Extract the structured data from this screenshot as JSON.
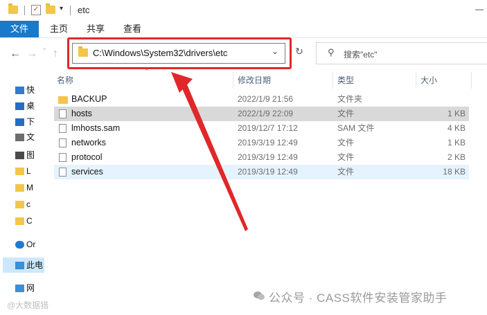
{
  "window": {
    "title": "etc",
    "minimize_glyph": "—"
  },
  "ribbon": {
    "tabs": [
      {
        "label": "文件"
      },
      {
        "label": "主页"
      },
      {
        "label": "共享"
      },
      {
        "label": "查看"
      }
    ]
  },
  "nav": {
    "back_glyph": "←",
    "forward_glyph": "→",
    "up_glyph": "↑",
    "recent_glyph": "⌄",
    "address": "C:\\Windows\\System32\\drivers\\etc",
    "address_dropdown_glyph": "⌄",
    "refresh_glyph": "↻",
    "search_placeholder": "搜索\"etc\"",
    "search_icon_glyph": "⚲"
  },
  "sidebar": {
    "items": [
      {
        "label": "快",
        "icon": "star-icon"
      },
      {
        "label": "桌",
        "icon": "desktop-icon"
      },
      {
        "label": "下",
        "icon": "download-icon"
      },
      {
        "label": "文",
        "icon": "document-icon"
      },
      {
        "label": "图",
        "icon": "picture-icon"
      },
      {
        "label": "L",
        "icon": "folder-icon"
      },
      {
        "label": "M",
        "icon": "folder-icon"
      },
      {
        "label": "c",
        "icon": "folder-icon"
      },
      {
        "label": "C",
        "icon": "folder-icon"
      },
      {
        "label": "Or",
        "icon": "cloud-icon"
      },
      {
        "label": "此电",
        "icon": "pc-icon"
      },
      {
        "label": "网",
        "icon": "network-icon"
      }
    ]
  },
  "columns": {
    "name": "名称",
    "modified": "修改日期",
    "type": "类型",
    "size": "大小"
  },
  "files": [
    {
      "name": "BACKUP",
      "modified": "2022/1/9 21:56",
      "type": "文件夹",
      "size": "",
      "kind": "folder"
    },
    {
      "name": "hosts",
      "modified": "2022/1/9 22:09",
      "type": "文件",
      "size": "1 KB",
      "kind": "file"
    },
    {
      "name": "lmhosts.sam",
      "modified": "2019/12/7 17:12",
      "type": "SAM 文件",
      "size": "4 KB",
      "kind": "file"
    },
    {
      "name": "networks",
      "modified": "2019/3/19 12:49",
      "type": "文件",
      "size": "1 KB",
      "kind": "file"
    },
    {
      "name": "protocol",
      "modified": "2019/3/19 12:49",
      "type": "文件",
      "size": "2 KB",
      "kind": "file"
    },
    {
      "name": "services",
      "modified": "2019/3/19 12:49",
      "type": "文件",
      "size": "18 KB",
      "kind": "file"
    }
  ],
  "watermark": {
    "main": "公众号 · CASS软件安装管家助手",
    "corner": "@大数据猎"
  },
  "colors": {
    "accent": "#1979ca",
    "highlight_red": "#e0282a",
    "selected_row": "#d9d9d9",
    "hover_row": "#e5f3ff"
  }
}
